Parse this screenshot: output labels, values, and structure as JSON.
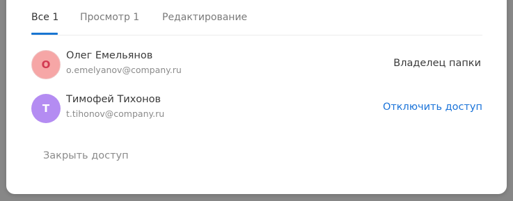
{
  "tabs": [
    {
      "label": "Все 1",
      "active": true
    },
    {
      "label": "Просмотр 1",
      "active": false
    },
    {
      "label": "Редактирование",
      "active": false
    }
  ],
  "users": [
    {
      "initial": "O",
      "name": "Олег Емельянов",
      "email": "o.emelyanov@company.ru",
      "role": "Владелец папки",
      "avatar_color": "#f6a6a6"
    },
    {
      "initial": "T",
      "name": "Тимофей Тихонов",
      "email": "t.tihonov@company.ru",
      "action": "Отключить доступ",
      "avatar_color": "#b48cf2"
    }
  ],
  "footer": {
    "close_access_label": "Закрыть доступ"
  },
  "colors": {
    "accent": "#1976d2",
    "link": "#1a73d9"
  }
}
